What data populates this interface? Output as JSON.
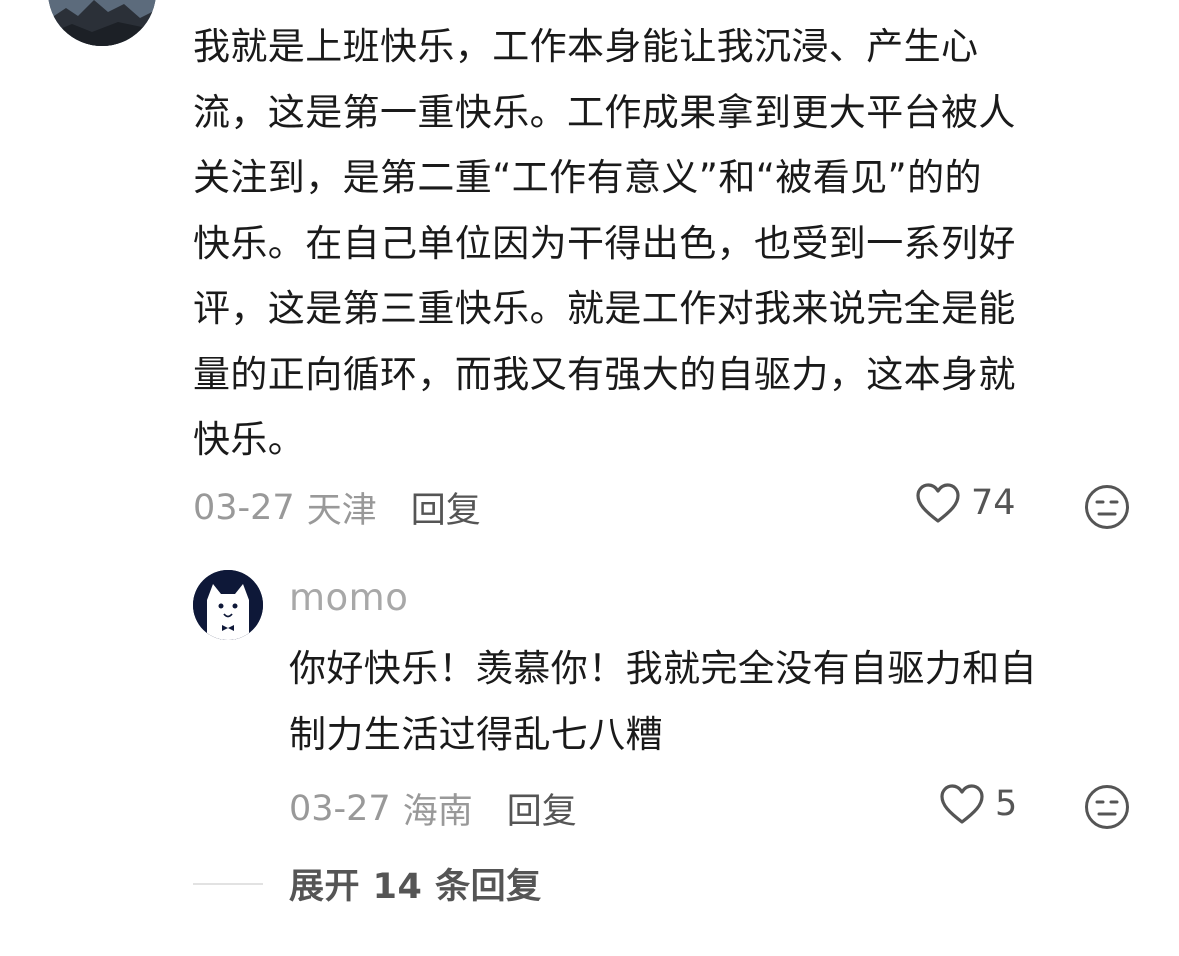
{
  "comment": {
    "text": "我就是上班快乐，工作本身能让我沉浸、产生心\n流，这是第一重快乐。工作成果拿到更大平台被人\n关注到，是第二重“工作有意义”和“被看见”的的\n快乐。在自己单位因为干得出色，也受到一系列好\n评，这是第三重快乐。就是工作对我来说完全是能\n量的正向循环，而我又有强大的自驱力，这本身就\n快乐。",
    "date": "03-27",
    "location": "天津",
    "reply_label": "回复",
    "likes": "74",
    "icons": {
      "like": "heart-outline-icon",
      "dislike": "meh-face-icon"
    }
  },
  "reply": {
    "username": "momo",
    "text": "你好快乐！羡慕你！我就完全没有自驱力和自\n制力生活过得乱七八糟",
    "date": "03-27",
    "location": "海南",
    "reply_label": "回复",
    "likes": "5"
  },
  "expand": {
    "label": "展开 14 条回复"
  },
  "colors": {
    "text": "#1a1a1a",
    "meta": "#999999",
    "action": "#555555",
    "username": "#a8a8a8"
  }
}
